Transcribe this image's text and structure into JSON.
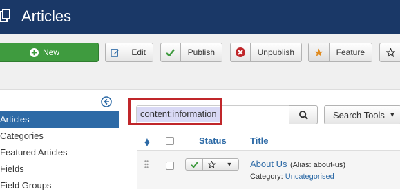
{
  "header": {
    "title": "Articles",
    "icon": "copy-icon",
    "bg_color": "#1a3867"
  },
  "toolbar": {
    "new_label": "New",
    "edit_label": "Edit",
    "publish_label": "Publish",
    "unpublish_label": "Unpublish",
    "feature_label": "Feature"
  },
  "sidebar": {
    "items": [
      {
        "label": "Articles",
        "active": true
      },
      {
        "label": "Categories",
        "active": false
      },
      {
        "label": "Featured Articles",
        "active": false
      },
      {
        "label": "Fields",
        "active": false
      },
      {
        "label": "Field Groups",
        "active": false
      }
    ]
  },
  "search": {
    "value": "content:information",
    "tools_label": "Search Tools"
  },
  "table": {
    "headers": {
      "status": "Status",
      "title": "Title"
    },
    "rows": [
      {
        "title": "About Us",
        "alias": "(Alias: about-us)",
        "category_prefix": "Category:",
        "category": "Uncategorised"
      }
    ]
  },
  "colors": {
    "accent": "#2d6aa6",
    "success": "#3f9b3f",
    "highlight_border": "#c0262a"
  }
}
